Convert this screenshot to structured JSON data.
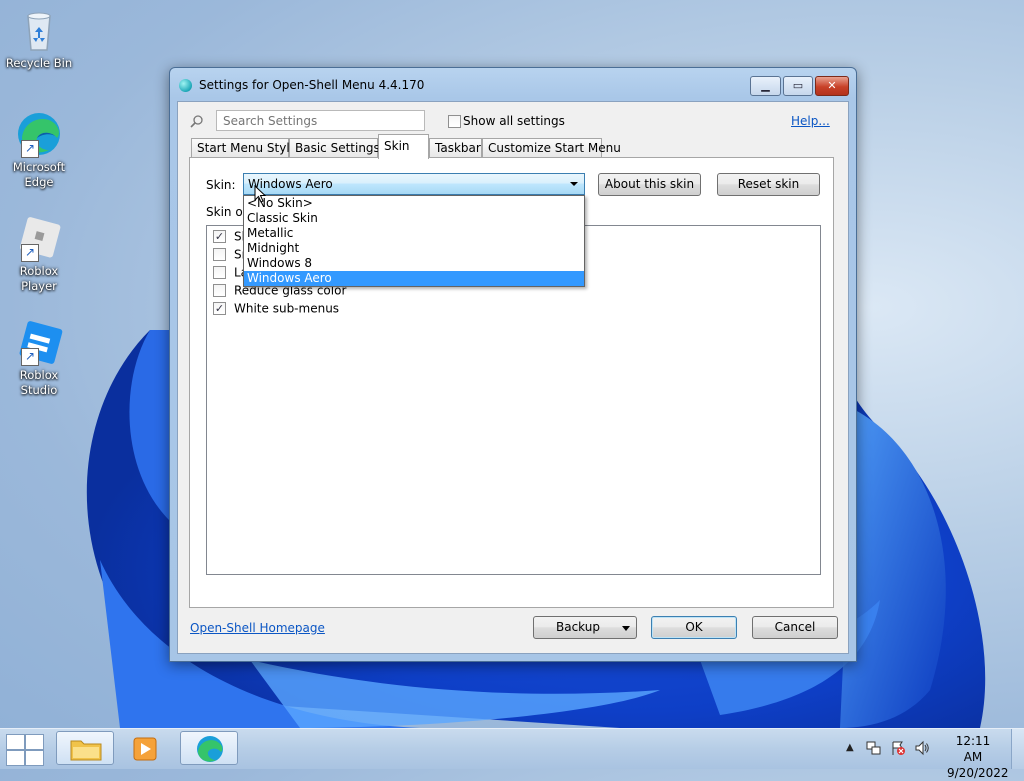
{
  "desktop": {
    "icons": [
      {
        "label": "Recycle Bin"
      },
      {
        "label": "Microsoft Edge"
      },
      {
        "label": "Roblox Player"
      },
      {
        "label": "Roblox Studio"
      }
    ]
  },
  "window": {
    "title": "Settings for Open-Shell Menu 4.4.170",
    "search_placeholder": "Search Settings",
    "show_all_label": "Show all settings",
    "show_all_checked": false,
    "help_link": "Help...",
    "tabs": [
      {
        "label": "Start Menu Style"
      },
      {
        "label": "Basic Settings"
      },
      {
        "label": "Skin",
        "active": true
      },
      {
        "label": "Taskbar"
      },
      {
        "label": "Customize Start Menu"
      }
    ],
    "skin_label": "Skin:",
    "skin_value": "Windows Aero",
    "about_skin": "About this skin",
    "reset_skin": "Reset skin",
    "skin_options_label": "Skin op",
    "dropdown_options": [
      "<No Skin>",
      "Classic Skin",
      "Metallic",
      "Midnight",
      "Windows 8",
      "Windows Aero"
    ],
    "dropdown_selected": "Windows Aero",
    "skin_options": [
      {
        "label": "Sh",
        "checked": true
      },
      {
        "label": "Sr",
        "checked": false
      },
      {
        "label": "La",
        "checked": false
      },
      {
        "label": "Reduce glass color",
        "checked": false
      },
      {
        "label": "White sub-menus",
        "checked": true
      }
    ],
    "homepage_link": "Open-Shell Homepage",
    "backup_button": "Backup",
    "ok_button": "OK",
    "cancel_button": "Cancel"
  },
  "taskbar": {
    "time": "12:11 AM",
    "date": "9/20/2022"
  },
  "colors": {
    "selection": "#3399ff",
    "link": "#0b56c4",
    "close_button": "#c84128"
  }
}
